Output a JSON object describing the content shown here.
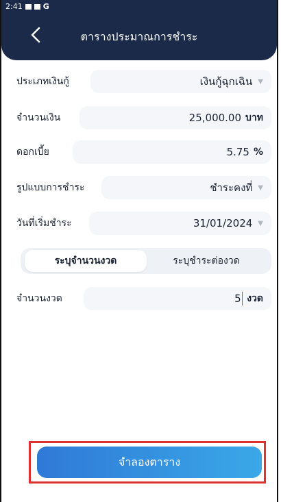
{
  "status_bar": {
    "time": "2:41",
    "carrier": "G"
  },
  "header": {
    "title": "ตารางประมาณการชำระ",
    "back_icon": "chevron-left-icon"
  },
  "form": {
    "loan_type": {
      "label": "ประเภทเงินกู้",
      "value": "เงินกู้ฉุกเฉิน"
    },
    "amount": {
      "label": "จำนวนเงิน",
      "value": "25,000.00",
      "unit": "บาท"
    },
    "interest": {
      "label": "ดอกเบี้ย",
      "value": "5.75",
      "unit": "%"
    },
    "payment_type": {
      "label": "รูปแบบการชำระ",
      "value": "ชำระคงที่"
    },
    "start_date": {
      "label": "วันที่เริ่มชำระ",
      "value": "31/01/2024"
    },
    "mode_tabs": {
      "active": "ระบุจำนวนงวด",
      "inactive": "ระบุชำระต่องวด"
    },
    "installments": {
      "label": "จำนวนงวด",
      "value": "5",
      "unit": "งวด"
    }
  },
  "simulate_button": {
    "label": "จำลองตาราง"
  },
  "colors": {
    "header_bg": "#1b2a48",
    "field_bg": "#f4f6f9",
    "button_start": "#2f79d6",
    "button_end": "#3aa8e8",
    "highlight": "#e03131"
  }
}
